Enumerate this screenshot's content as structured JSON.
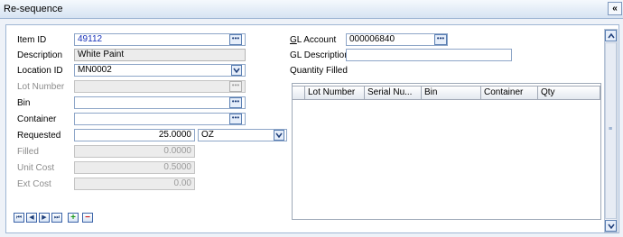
{
  "window": {
    "title": "Re-sequence",
    "collapse_glyph": "«"
  },
  "form": {
    "item_id": {
      "label": "Item ID",
      "value": "49112"
    },
    "description": {
      "label": "Description",
      "value": "White Paint"
    },
    "location_id": {
      "label": "Location ID",
      "value": "MN0002"
    },
    "lot_number": {
      "label": "Lot Number",
      "value": ""
    },
    "bin": {
      "label": "Bin",
      "value": ""
    },
    "container": {
      "label": "Container",
      "value": ""
    },
    "requested": {
      "label": "Requested",
      "value": "25.0000",
      "uom": "OZ"
    },
    "filled": {
      "label": "Filled",
      "value": "0.0000"
    },
    "unit_cost": {
      "label": "Unit Cost",
      "value": "0.5000"
    },
    "ext_cost": {
      "label": "Ext Cost",
      "value": "0.00"
    },
    "gl_account": {
      "label_underlined": "G",
      "label_rest": "L Account",
      "value": "000006840"
    },
    "gl_description": {
      "label": "GL Description",
      "value": ""
    },
    "quantity_filled": {
      "label": "Quantity Filled"
    }
  },
  "grid": {
    "columns": [
      "Lot Number",
      "Serial Nu...",
      "Bin",
      "Container",
      "Qty"
    ]
  },
  "icons": {
    "lookup": "ellipsis-icon",
    "dropdown": "chevron-down-icon",
    "nav_first": "first-record-icon",
    "nav_prev": "previous-record-icon",
    "nav_next": "next-record-icon",
    "nav_last": "last-record-icon",
    "add": "plus-icon",
    "remove": "minus-icon"
  },
  "colors": {
    "link_blue": "#1530b8",
    "add_green": "#1d9a1d",
    "remove_red": "#cc1a1a"
  }
}
